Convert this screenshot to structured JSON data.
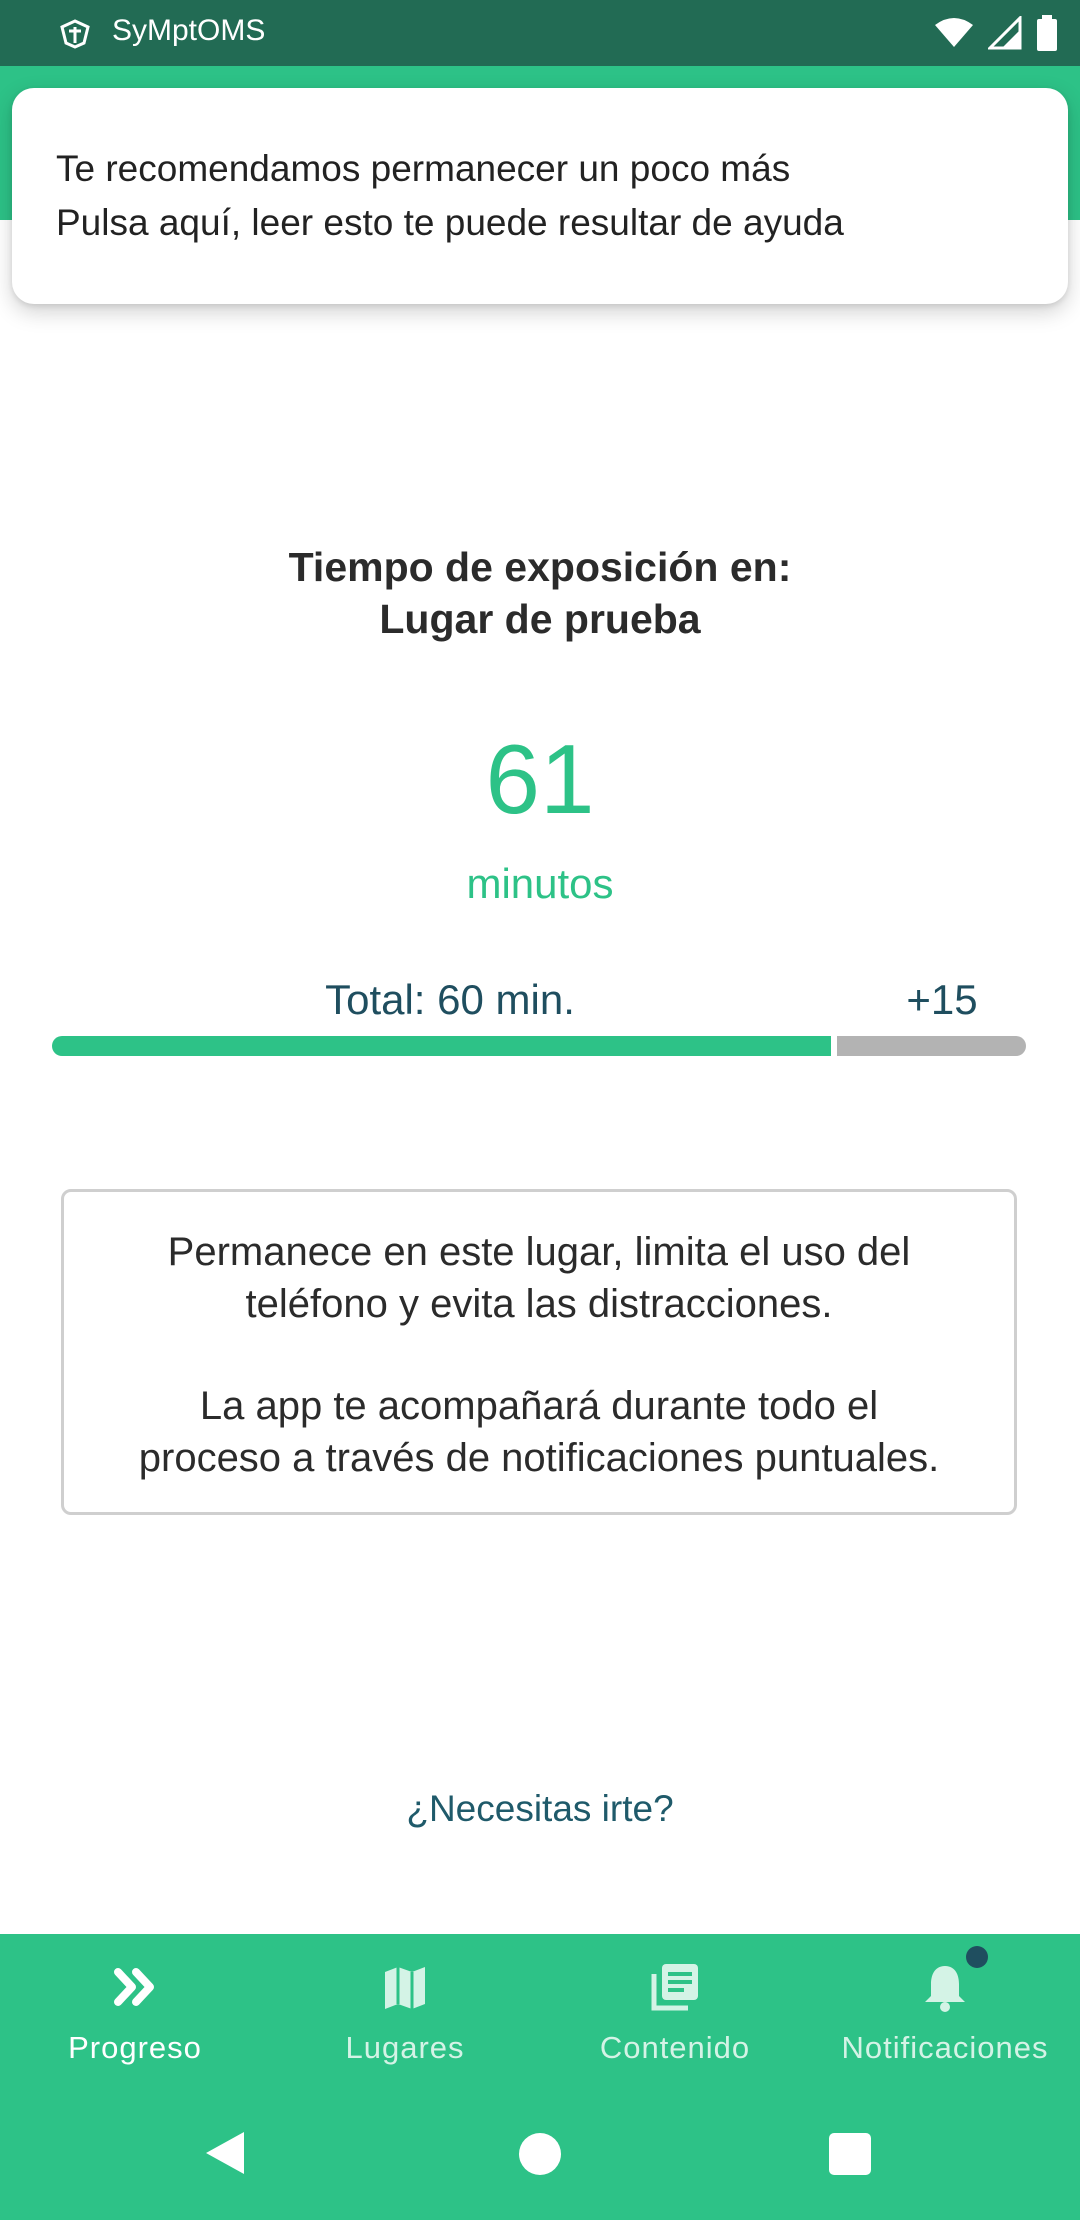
{
  "status_bar": {
    "app_name": "SyMptOMS",
    "icons": [
      "app-logo-icon",
      "wifi-icon",
      "cell-signal-icon",
      "battery-icon"
    ]
  },
  "notification": {
    "line1": "Te recomendamos permanecer un poco más",
    "line2": "Pulsa aquí, leer esto te puede resultar de ayuda"
  },
  "exposure": {
    "title_line1": "Tiempo de exposición en:",
    "title_line2": "Lugar de prueba",
    "minutes_value": "61",
    "minutes_unit": "minutos",
    "total_label": "Total: 60 min.",
    "extra_label": "+15",
    "total_minutes": 60,
    "extra_minutes": 15
  },
  "info_box": {
    "p1_line1": "Permanece en este lugar, limita el uso del",
    "p1_line2": "teléfono y evita las distracciones.",
    "p2_line1": "La app te acompañará durante todo el",
    "p2_line2": "proceso a través de notificaciones puntuales."
  },
  "leave_link": "¿Necesitas irte?",
  "bottom_nav": {
    "items": [
      {
        "label": "Progreso",
        "icon": "double-chevron-right-icon",
        "active": true
      },
      {
        "label": "Lugares",
        "icon": "map-icon",
        "active": false
      },
      {
        "label": "Contenido",
        "icon": "articles-icon",
        "active": false
      },
      {
        "label": "Notificaciones",
        "icon": "bell-icon",
        "active": false,
        "has_badge": true
      }
    ]
  },
  "system_nav": [
    "back-icon",
    "home-icon",
    "recents-icon"
  ],
  "colors": {
    "status_bar": "#226b54",
    "accent": "#2dc287",
    "dark_text": "#1f4e5f",
    "progress_remaining": "#b3b3b3"
  }
}
